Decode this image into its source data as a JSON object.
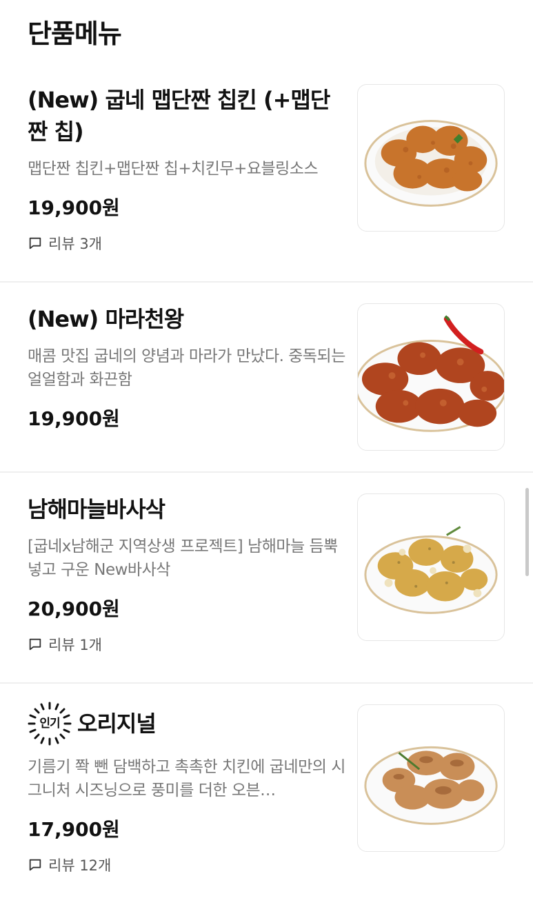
{
  "section_title": "단품메뉴",
  "items": [
    {
      "name": "(New) 굽네 맵단짠 칩킨 (+맵단짠 칩)",
      "description": "맵단짠 칩킨+맵단짠 칩+치킨무+요블링소스",
      "price": "19,900원",
      "review": "리뷰 3개",
      "image_icon": "fried-chicken-plate"
    },
    {
      "name": "(New) 마라천왕",
      "description": "매콤 맛집 굽네의 양념과 마라가 만났다. 중독되는 얼얼함과 화끈함",
      "price": "19,900원",
      "image_icon": "spicy-chicken-plate"
    },
    {
      "name": "남해마늘바사삭",
      "description": "[굽네x남해군 지역상생 프로젝트] 남해마늘 듬뿍 넣고 구운 New바사삭",
      "price": "20,900원",
      "review": "리뷰 1개",
      "image_icon": "garlic-chicken-plate"
    },
    {
      "name": "오리지널",
      "badge": "인기",
      "description": "기름기 쫙 뺀 담백하고 촉촉한 치킨에 굽네만의 시그니처 시즈닝으로 풍미를 더한 오븐…",
      "price": "17,900원",
      "review": "리뷰 12개",
      "image_icon": "roasted-chicken-plate"
    }
  ],
  "colors": {
    "chicken_crispy": "#c8742c",
    "chicken_red": "#b0451f",
    "chicken_garlic": "#d6a94a",
    "chicken_roast": "#c98e57",
    "plate_rim": "#d9c29a"
  }
}
